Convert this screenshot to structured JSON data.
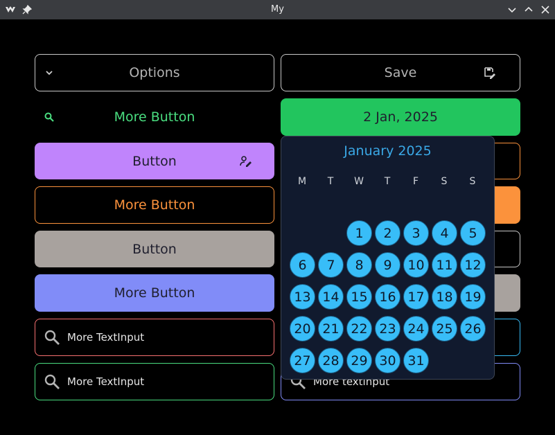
{
  "window": {
    "title": "My"
  },
  "left_column": {
    "options_button": {
      "label": "Options",
      "icon": "chevron-down-icon",
      "border": "#c8c8c8",
      "text": "#b4b4b4"
    },
    "more_button_green": {
      "label": "More Button",
      "icon": "search-icon",
      "text": "#4ade80"
    },
    "button_purple": {
      "label": "Button",
      "icon": "user-edit-icon",
      "bg": "#c084fc",
      "text": "#1f1f2e"
    },
    "more_button_orange": {
      "label": "More Button",
      "border": "#fb923c",
      "text": "#fb923c"
    },
    "button_gray": {
      "label": "Button",
      "bg": "#a8a29e",
      "text": "#1f1f2e"
    },
    "more_button_blue": {
      "label": "More Button",
      "bg": "#818cf8",
      "text": "#1f1f2e"
    },
    "text_input_red": {
      "placeholder": "More TextInput",
      "icon": "search-icon",
      "border": "#f87171"
    },
    "text_input_green": {
      "placeholder": "More TextInput",
      "icon": "search-icon",
      "border": "#4ade80"
    }
  },
  "right_column": {
    "save_button": {
      "label": "Save",
      "icon": "save-edit-icon",
      "border": "#c8c8c8",
      "text": "#b4b4b4"
    },
    "date_button": {
      "label": "2 Jan, 2025",
      "bg": "#22c55e",
      "text": "#1f1f2e"
    },
    "text_input_blue": {
      "value": "More textinput",
      "icon": "search-icon",
      "border": "#818cf8"
    }
  },
  "datepicker": {
    "month_label": "January 2025",
    "weekdays": [
      "M",
      "T",
      "W",
      "T",
      "F",
      "S",
      "S"
    ],
    "days": [
      "1",
      "2",
      "3",
      "4",
      "5",
      "6",
      "7",
      "8",
      "9",
      "10",
      "11",
      "12",
      "13",
      "14",
      "15",
      "16",
      "17",
      "18",
      "19",
      "20",
      "21",
      "22",
      "23",
      "24",
      "25",
      "26",
      "27",
      "28",
      "29",
      "30",
      "31"
    ],
    "accent": "#38bdf8"
  }
}
